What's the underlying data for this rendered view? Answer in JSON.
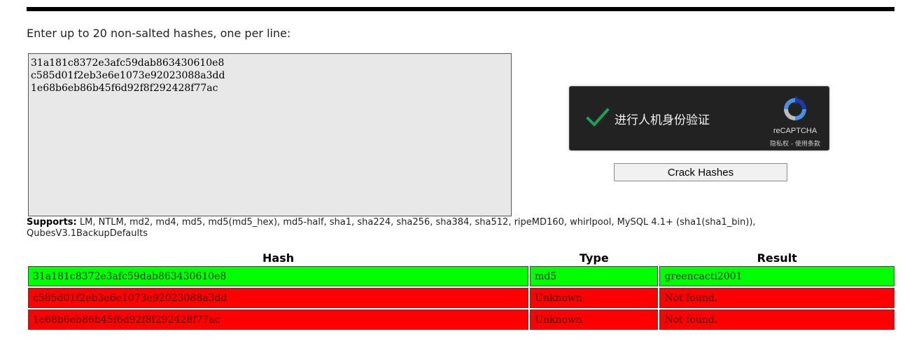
{
  "instructions": "Enter up to 20 non-salted hashes, one per line:",
  "input": {
    "value": "31a181c8372e3afc59dab863430610e8\nc585d01f2eb3e6e1073e92023088a3dd\n1e68b6eb86b45f6d92f8f292428f77ac"
  },
  "recaptcha": {
    "label": "进行人机身份验证",
    "brand": "reCAPTCHA",
    "links": "隐私权 - 使用条款",
    "check_color": "#1fa05a",
    "check_icon": "checkmark-icon",
    "logo_icon": "recaptcha-logo-icon"
  },
  "crack_button": "Crack Hashes",
  "supports": {
    "label": "Supports:",
    "text": " LM, NTLM, md2, md4, md5, md5(md5_hex), md5-half, sha1, sha224, sha256, sha384, sha512, ripeMD160, whirlpool, MySQL 4.1+ (sha1(sha1_bin)), QubesV3.1BackupDefaults"
  },
  "results": {
    "headers": [
      "Hash",
      "Type",
      "Result"
    ],
    "rows": [
      {
        "hash": "31a181c8372e3afc59dab863430610e8",
        "type": "md5",
        "result": "greencacti2001",
        "status": "found"
      },
      {
        "hash": "c585d01f2eb3e6e1073e92023088a3dd",
        "type": "Unknown",
        "result": "Not found.",
        "status": "notfound"
      },
      {
        "hash": "1e68b6eb86b45f6d92f8f292428f77ac",
        "type": "Unknown",
        "result": "Not found.",
        "status": "notfound"
      }
    ],
    "colors": {
      "found": "#00ff00",
      "notfound": "#ff0000"
    }
  }
}
